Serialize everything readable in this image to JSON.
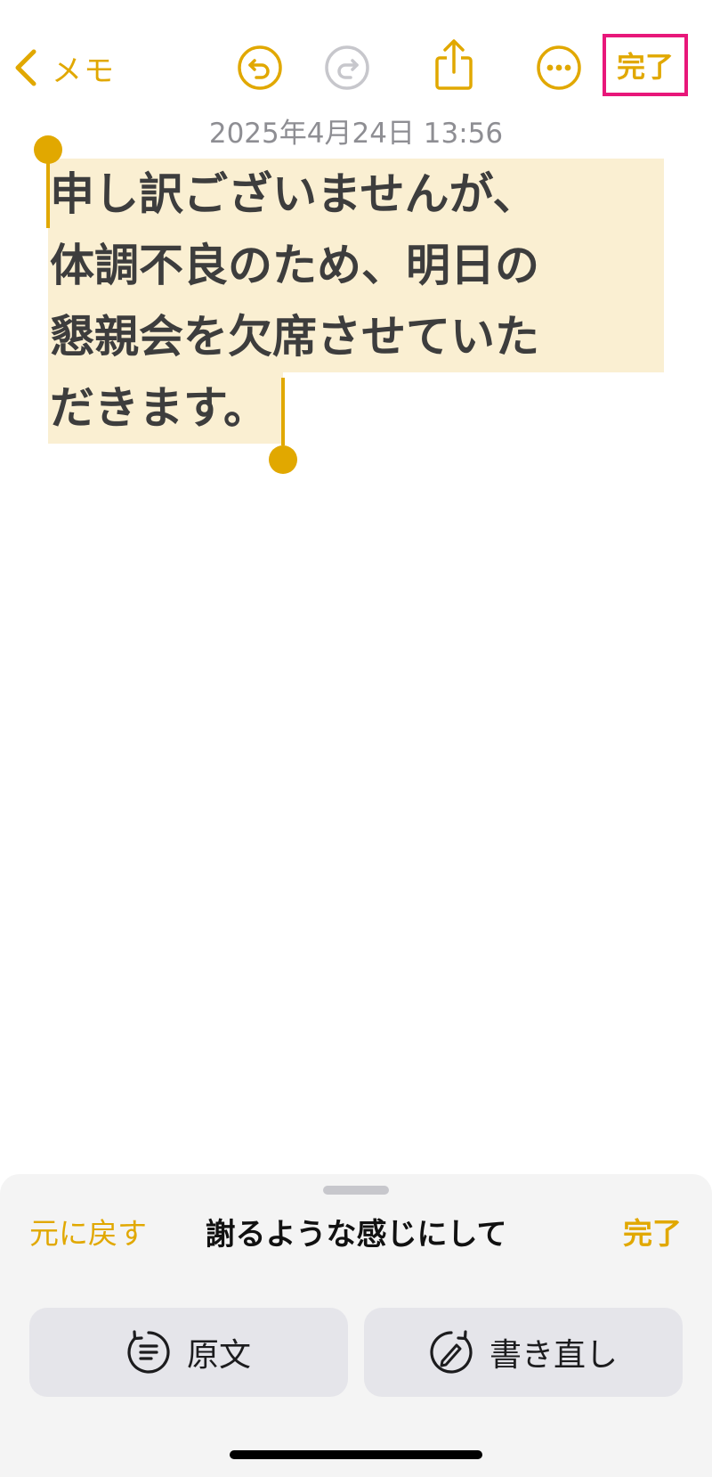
{
  "nav": {
    "back_label": "メモ",
    "done_label": "完了",
    "icons": [
      "chevron-left-icon",
      "undo-icon",
      "redo-icon",
      "share-icon",
      "more-icon"
    ]
  },
  "note": {
    "timestamp": "2025年4月24日 13:56",
    "lines": [
      "申し訳ございませんが、",
      "体調不良のため、明日の",
      "懇親会を欠席させていた",
      "だきます。"
    ]
  },
  "sheet": {
    "revert_label": "元に戻す",
    "prompt_text": "謝るような感じにして",
    "done_label": "完了",
    "original_label": "原文",
    "rewrite_label": "書き直し"
  },
  "colors": {
    "accent": "#E1A800",
    "highlight": "#FAEFD2",
    "callout_border": "#E8177A"
  }
}
